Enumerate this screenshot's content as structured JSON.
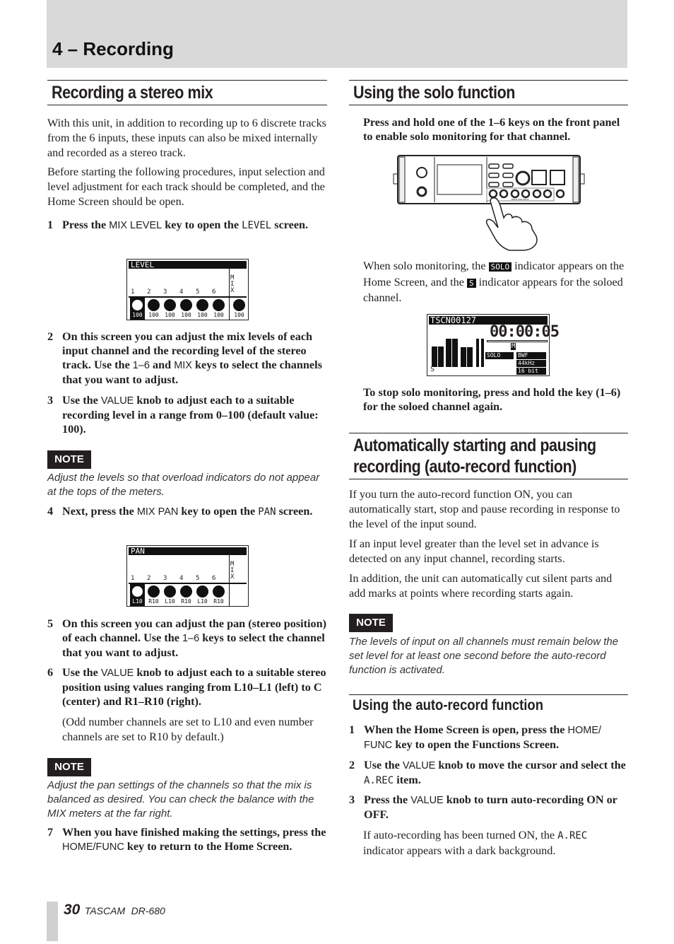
{
  "header": {
    "title": "4 – Recording"
  },
  "left": {
    "heading": "Recording a stereo mix",
    "para1": [
      {
        "t": "With this unit, in addition to recording up to 6 discrete tracks from the 6 inputs, these inputs can also be mixed internally and recorded as a stereo track."
      }
    ],
    "para2": [
      {
        "t": "Before starting the following procedures, input selection and level adjustment for each track should be completed, and the Home Screen should be open."
      }
    ],
    "step1": {
      "num": "1",
      "text": [
        {
          "t": "Press the "
        },
        {
          "t": "MIX LEVEL",
          "k": "key"
        },
        {
          "t": " key to open the "
        },
        {
          "t": "LEVEL",
          "k": "lcd"
        },
        {
          "t": " screen."
        }
      ]
    },
    "level_screen": {
      "title": "LEVEL",
      "channels": [
        "1",
        "2",
        "3",
        "4",
        "5",
        "6"
      ],
      "mix_label": "MIX",
      "values": [
        "100",
        "100",
        "100",
        "100",
        "100",
        "100",
        "100"
      ]
    },
    "step2": {
      "num": "2",
      "text": [
        {
          "t": "On this screen you can adjust the mix levels of each input channel and the recording level of the stereo track. Use the "
        },
        {
          "t": "1–6",
          "k": "key"
        },
        {
          "t": " and "
        },
        {
          "t": "MIX",
          "k": "key"
        },
        {
          "t": " keys to select the channels that you want to adjust."
        }
      ]
    },
    "step3": {
      "num": "3",
      "text": [
        {
          "t": "Use the "
        },
        {
          "t": "VALUE",
          "k": "key"
        },
        {
          "t": " knob to adjust each to a suitable recording level in a range from 0–100 (default value: 100)."
        }
      ]
    },
    "note1_label": "NOTE",
    "note1": "Adjust the levels so that overload indicators do not appear at the tops of the meters.",
    "step4": {
      "num": "4",
      "text": [
        {
          "t": "Next, press the "
        },
        {
          "t": "MIX PAN",
          "k": "key"
        },
        {
          "t": " key to open the "
        },
        {
          "t": "PAN",
          "k": "lcd"
        },
        {
          "t": " screen."
        }
      ]
    },
    "pan_screen": {
      "title": "PAN",
      "channels": [
        "1",
        "2",
        "3",
        "4",
        "5",
        "6"
      ],
      "mix_label": "MIX",
      "values": [
        "L10",
        "R10",
        "L10",
        "R10",
        "L10",
        "R10"
      ]
    },
    "step5": {
      "num": "5",
      "text": [
        {
          "t": "On this screen you can adjust the pan (stereo position) of each channel. Use the "
        },
        {
          "t": "1–6",
          "k": "key"
        },
        {
          "t": " keys to select the channel that you want to adjust."
        }
      ]
    },
    "step6": {
      "num": "6",
      "text": [
        {
          "t": "Use the "
        },
        {
          "t": "VALUE",
          "k": "key"
        },
        {
          "t": " knob to adjust each to a suitable stereo position using values ranging from L10–L1 (left) to C (center) and R1–R10 (right)."
        }
      ]
    },
    "step6_note": [
      {
        "t": "(Odd number channels are set to L10 and even number channels are set to R10 by default.)"
      }
    ],
    "note2_label": "NOTE",
    "note2": "Adjust the pan settings of the channels so that the mix is balanced as desired. You can check the balance with the MIX meters at the far right.",
    "step7": {
      "num": "7",
      "text": [
        {
          "t": "When you have finished making the settings, press the "
        },
        {
          "t": "HOME/FUNC",
          "k": "key"
        },
        {
          "t": " key to return to the Home Screen."
        }
      ]
    }
  },
  "right": {
    "heading": "Using the solo function",
    "intro": [
      {
        "t": "Press and hold one of the 1–6 keys on the front panel to enable solo monitoring for that channel."
      }
    ],
    "device": {
      "key_label": "HOLD FOR SOLO"
    },
    "para1": [
      {
        "t": "When solo monitoring, the "
      },
      {
        "t": "SOLO",
        "k": "inv"
      },
      {
        "t": " indicator appears on the Home Screen, and the "
      },
      {
        "t": "S",
        "k": "inv"
      },
      {
        "t": " indicator appears for the soloed channel."
      }
    ],
    "home_screen": {
      "take": "TSCN00127",
      "time": "00:00:05",
      "solo": "SOLO",
      "format": "BWF",
      "rate": "44kHz",
      "bits": "16 bit",
      "m": "M",
      "s": "S"
    },
    "stop": [
      {
        "t": "To stop solo monitoring, press and hold the key (1–6) for the soloed channel again."
      }
    ],
    "heading2": [
      "Automatically starting and pausing",
      "recording (auto-record function)"
    ],
    "para2": [
      {
        "t": "If you turn the auto-record function ON, you can automatically start, stop and pause recording in response to the level of the input sound."
      }
    ],
    "para3": [
      {
        "t": "If an input level greater than the level set in advance is detected on any input channel, recording starts."
      }
    ],
    "para4": [
      {
        "t": "In addition, the unit can automatically cut silent parts and add marks at points where recording starts again."
      }
    ],
    "note_label": "NOTE",
    "note": "The levels of input on all channels must remain below the set level for at least one second before the auto-record function is activated.",
    "subheading": "Using the auto-record function",
    "step1": {
      "num": "1",
      "text": [
        {
          "t": "When the Home Screen is open, press the "
        },
        {
          "t": "HOME/ FUNC",
          "k": "key"
        },
        {
          "t": " key to open the Functions Screen."
        }
      ]
    },
    "step2": {
      "num": "2",
      "text": [
        {
          "t": "Use the "
        },
        {
          "t": "VALUE",
          "k": "key"
        },
        {
          "t": " knob to move the cursor and select the "
        },
        {
          "t": "A.REC",
          "k": "lcd"
        },
        {
          "t": " item."
        }
      ]
    },
    "step3": {
      "num": "3",
      "text": [
        {
          "t": "Press the "
        },
        {
          "t": "VALUE",
          "k": "key"
        },
        {
          "t": " knob to turn auto-recording ON or OFF."
        }
      ]
    },
    "step3_note": [
      {
        "t": "If auto-recording has been turned ON, the "
      },
      {
        "t": "A.REC",
        "k": "lcd"
      },
      {
        "t": " indicator appears with a dark background."
      }
    ]
  },
  "footer": {
    "page": "30",
    "brand": "TASCAM",
    "model": "DR-680"
  }
}
